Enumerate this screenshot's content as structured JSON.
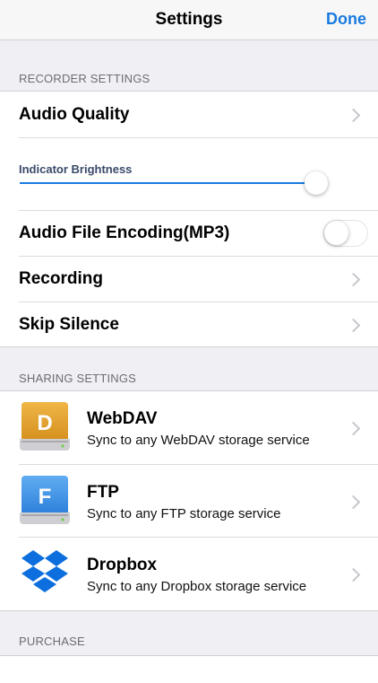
{
  "navbar": {
    "title": "Settings",
    "done_label": "Done"
  },
  "recorder": {
    "header": "RECORDER SETTINGS",
    "audio_quality": "Audio Quality",
    "brightness_label": "Indicator Brightness",
    "brightness_value": 1.0,
    "encoding_label": "Audio File Encoding(MP3)",
    "encoding_on": false,
    "recording": "Recording",
    "skip_silence": "Skip Silence"
  },
  "sharing": {
    "header": "SHARING SETTINGS",
    "services": [
      {
        "title": "WebDAV",
        "subtitle": "Sync to any WebDAV storage service",
        "icon": "webdav-drive-icon",
        "letter": "D",
        "color": "#e6a532"
      },
      {
        "title": "FTP",
        "subtitle": "Sync to any FTP storage service",
        "icon": "ftp-drive-icon",
        "letter": "F",
        "color": "#3a8fe6"
      },
      {
        "title": "Dropbox",
        "subtitle": "Sync to any Dropbox storage service",
        "icon": "dropbox-icon",
        "color": "#0d6fde"
      }
    ]
  },
  "purchase": {
    "header": "PURCHASE"
  }
}
